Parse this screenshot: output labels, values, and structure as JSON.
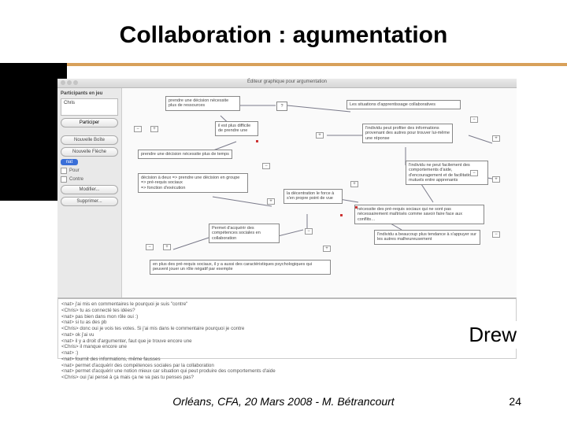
{
  "slide": {
    "title": "Collaboration : agumentation",
    "tool_label": "Drew",
    "footer": "Orléans, CFA, 20 Mars 2008 - M. Bétrancourt",
    "page": "24"
  },
  "window": {
    "title": "Éditeur graphique pour argumentation"
  },
  "sidebar": {
    "header": "Participants en jeu",
    "user": "Chris",
    "btn_participer": "Participer",
    "btn_nouvelle_boite": "Nouvelle Boîte",
    "btn_nouvelle_fleche": "Nouvelle Flèche",
    "badge_nat": "nat",
    "chk_pour": "Pour",
    "chk_contre": "Contre",
    "btn_modifier": "Modifier...",
    "btn_supprimer": "Supprimer..."
  },
  "nodes": {
    "n1": "prendre une décision nécessite plus de ressources",
    "n2": "?",
    "n3": "Les situations d'apprentissage collaboratives",
    "n4": "il est plus difficile de prendre une",
    "n5": "prendre une décision nécessite plus de temps",
    "n6": "l'individu peut profiter des informations provenant des autres pour trouver lui-même une réponse",
    "n7": "décision à deux => prendre une décision en groupe\n=> pré-requis sociaux\n=> fonction d'exécution",
    "n8": "l'individu ne peut facilement des comportements d'aide, d'encouragement et de facilitation mutuels entre apprenants",
    "n9": "la décentration le force à s'en propre point de vue",
    "n10": "Permet d'acquérir des compétences sociales en collaboration",
    "n11": "nécessite des pré-requis sociaux qui ne sont pas nécessairement maîtrisés comme savoir faire face aux conflits…",
    "n12": "l'individu a beaucoup plus tendance à s'appuyer sur les autres malheureusement",
    "n13": "en plus des pré-requis sociaux, il y a aussi des caractéristiques psychologiques qui peuvent jouer un rôle négatif par exemple"
  },
  "chat": {
    "l0": "<nat> j'ai mis en commentaires le pourquoi je suis \"contre\"",
    "l1": "<Chris> tu as connecté tes idées?",
    "l2": "<nat> pas bien dans mon rôle oui :)",
    "l3": "<nat> si tu as des pb",
    "l4": "<Chris> donc oui je vois tes votes. Si j'ai mis dans le commentaire pourquoi je contre",
    "l5": "<nat> ok j'ai vu",
    "l6": "<nat> il y a droit d'argumenter, faut que je trouve encore une",
    "l7": "<Chris> il manque encore une",
    "l8": "<nat> :)",
    "l9": "<nat> fournit des informations, même fausses",
    "l10": "<nat> permet d'acquérir des compétences sociales par la collaboration",
    "l11": "<nat> permet d'acquérir une notion mieux car situation qui peut produire des comportements d'aide",
    "l12": "<Chris> oui j'ai pensé à ça mais ça ne va pas tu penses pas?"
  }
}
